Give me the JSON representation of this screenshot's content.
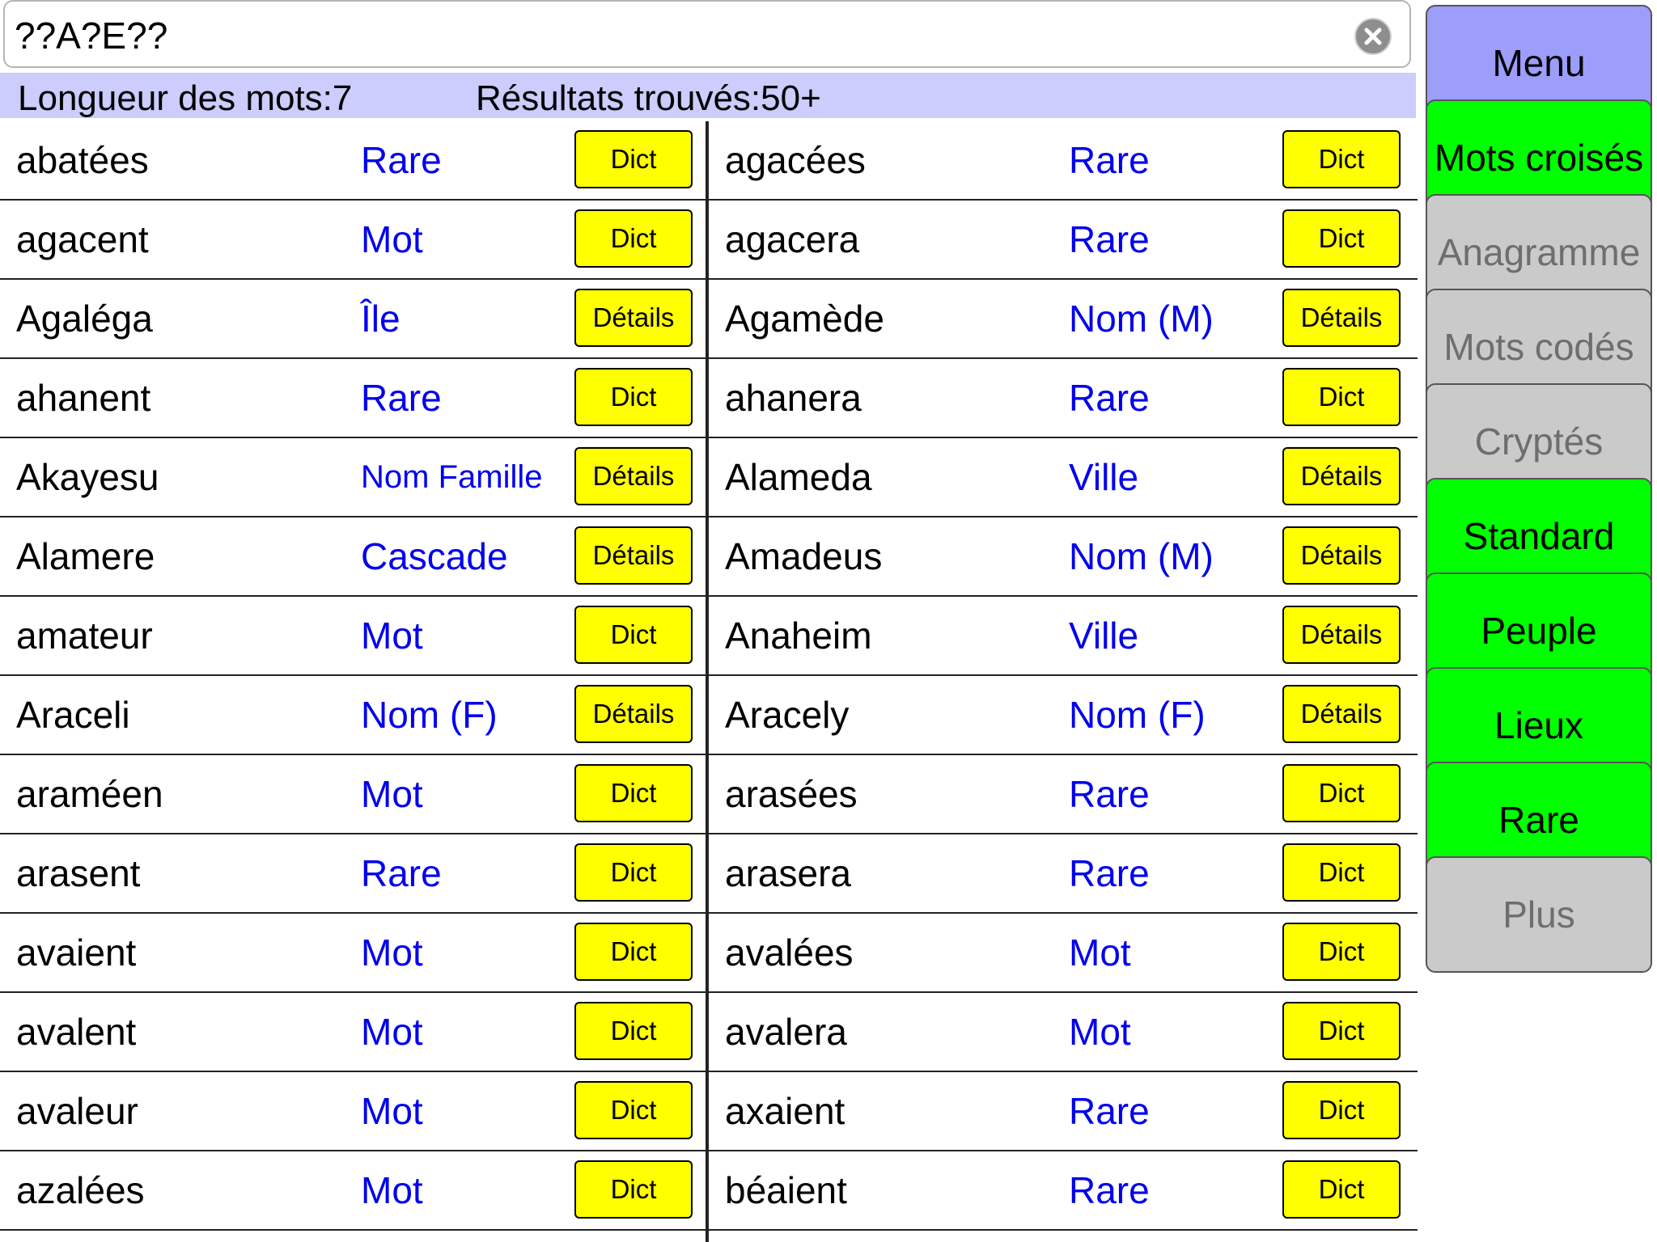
{
  "search": {
    "value": "??A?E??"
  },
  "info": {
    "length": "Longueur des mots:7",
    "results": "Résultats trouvés:50+"
  },
  "sidebar": {
    "buttons": [
      {
        "label": "Menu",
        "state": "menu"
      },
      {
        "label": "Mots croisés",
        "state": "on"
      },
      {
        "label": "Anagramme",
        "state": "off"
      },
      {
        "label": "Mots codés",
        "state": "off"
      },
      {
        "label": "Cryptés",
        "state": "off"
      },
      {
        "label": "Standard",
        "state": "on"
      },
      {
        "label": "Peuple",
        "state": "on"
      },
      {
        "label": "Lieux",
        "state": "on"
      },
      {
        "label": "Rare",
        "state": "on"
      },
      {
        "label": "Plus",
        "state": "off"
      }
    ]
  },
  "rows": [
    {
      "left": {
        "word": "abatées",
        "cat": "Rare",
        "btn": "Dict"
      },
      "right": {
        "word": "agacées",
        "cat": "Rare",
        "btn": "Dict"
      }
    },
    {
      "left": {
        "word": "agacent",
        "cat": "Mot",
        "btn": "Dict"
      },
      "right": {
        "word": "agacera",
        "cat": "Rare",
        "btn": "Dict"
      }
    },
    {
      "left": {
        "word": "Agaléga",
        "cat": "Île",
        "btn": "Détails"
      },
      "right": {
        "word": "Agamède",
        "cat": "Nom (M)",
        "btn": "Détails"
      }
    },
    {
      "left": {
        "word": "ahanent",
        "cat": "Rare",
        "btn": "Dict"
      },
      "right": {
        "word": "ahanera",
        "cat": "Rare",
        "btn": "Dict"
      }
    },
    {
      "left": {
        "word": "Akayesu",
        "cat": "Nom Famille",
        "btn": "Détails"
      },
      "right": {
        "word": "Alameda",
        "cat": "Ville",
        "btn": "Détails"
      }
    },
    {
      "left": {
        "word": "Alamere",
        "cat": "Cascade",
        "btn": "Détails"
      },
      "right": {
        "word": "Amadeus",
        "cat": "Nom (M)",
        "btn": "Détails"
      }
    },
    {
      "left": {
        "word": "amateur",
        "cat": "Mot",
        "btn": "Dict"
      },
      "right": {
        "word": "Anaheim",
        "cat": "Ville",
        "btn": "Détails"
      }
    },
    {
      "left": {
        "word": "Araceli",
        "cat": "Nom (F)",
        "btn": "Détails"
      },
      "right": {
        "word": "Aracely",
        "cat": "Nom (F)",
        "btn": "Détails"
      }
    },
    {
      "left": {
        "word": "araméen",
        "cat": "Mot",
        "btn": "Dict"
      },
      "right": {
        "word": "arasées",
        "cat": "Rare",
        "btn": "Dict"
      }
    },
    {
      "left": {
        "word": "arasent",
        "cat": "Rare",
        "btn": "Dict"
      },
      "right": {
        "word": "arasera",
        "cat": "Rare",
        "btn": "Dict"
      }
    },
    {
      "left": {
        "word": "avaient",
        "cat": "Mot",
        "btn": "Dict"
      },
      "right": {
        "word": "avalées",
        "cat": "Mot",
        "btn": "Dict"
      }
    },
    {
      "left": {
        "word": "avalent",
        "cat": "Mot",
        "btn": "Dict"
      },
      "right": {
        "word": "avalera",
        "cat": "Mot",
        "btn": "Dict"
      }
    },
    {
      "left": {
        "word": "avaleur",
        "cat": "Mot",
        "btn": "Dict"
      },
      "right": {
        "word": "axaient",
        "cat": "Rare",
        "btn": "Dict"
      }
    },
    {
      "left": {
        "word": "azalées",
        "cat": "Mot",
        "btn": "Dict"
      },
      "right": {
        "word": "béaient",
        "cat": "Rare",
        "btn": "Dict"
      }
    }
  ]
}
